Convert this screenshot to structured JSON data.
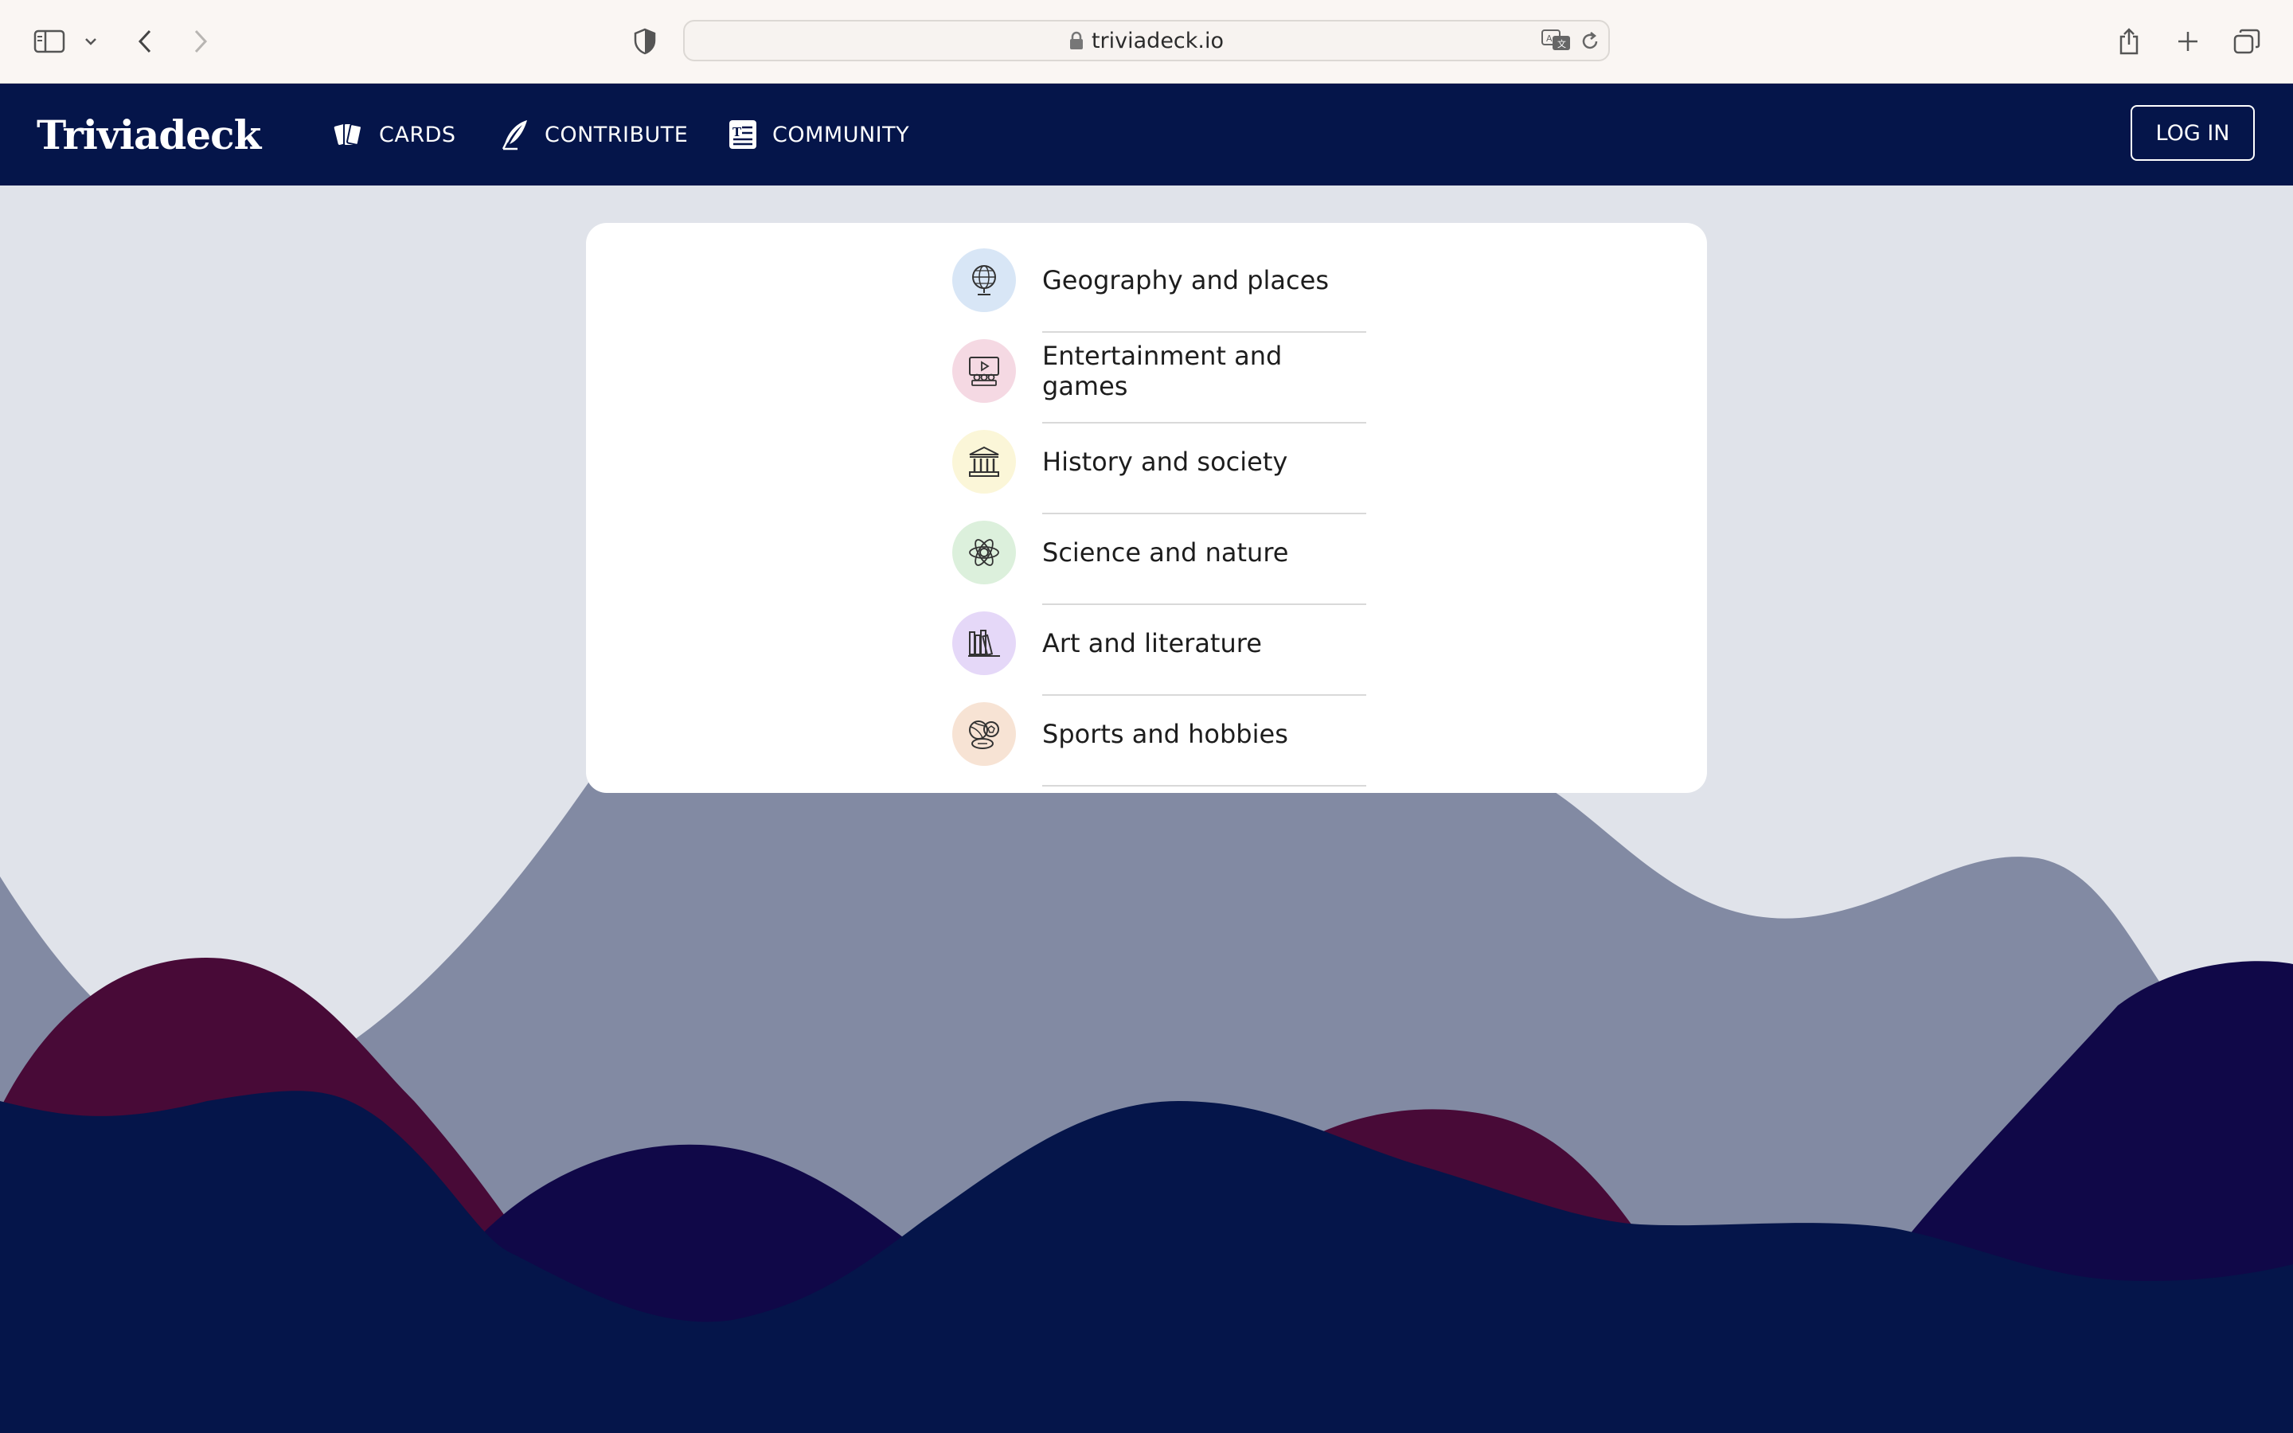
{
  "browser": {
    "url": "triviadeck.io",
    "icons": [
      "sidebar-toggle-icon",
      "chevron-down-icon",
      "back-arrow-icon",
      "forward-arrow-icon",
      "privacy-shield-icon",
      "lock-icon",
      "translate-icon",
      "reload-icon",
      "share-icon",
      "new-tab-plus-icon",
      "tab-overview-icon"
    ]
  },
  "site": {
    "logo": "Triviadeck",
    "nav": {
      "cards": "CARDS",
      "contribute": "CONTRIBUTE",
      "community": "COMMUNITY"
    },
    "login": "LOG IN"
  },
  "categories": [
    {
      "label": "Geography and places",
      "icon": "globe-icon",
      "bg": "#d8e6f6"
    },
    {
      "label": "Entertainment and games",
      "icon": "movie-screen-icon",
      "bg": "#f5d9e3"
    },
    {
      "label": "History and society",
      "icon": "museum-icon",
      "bg": "#fbf6d8"
    },
    {
      "label": "Science and nature",
      "icon": "atom-icon",
      "bg": "#dcf0dc"
    },
    {
      "label": "Art and literature",
      "icon": "books-icon",
      "bg": "#e5d8f8"
    },
    {
      "label": "Sports and hobbies",
      "icon": "sports-balls-icon",
      "bg": "#f7e3d4"
    }
  ],
  "colors": {
    "nav_background": "#05154a",
    "page_background": "#e0e3ea",
    "hill_gray": "#828aa3",
    "hill_maroon": "#480a37",
    "hill_indigo": "#100848",
    "hill_navy": "#05154a"
  }
}
